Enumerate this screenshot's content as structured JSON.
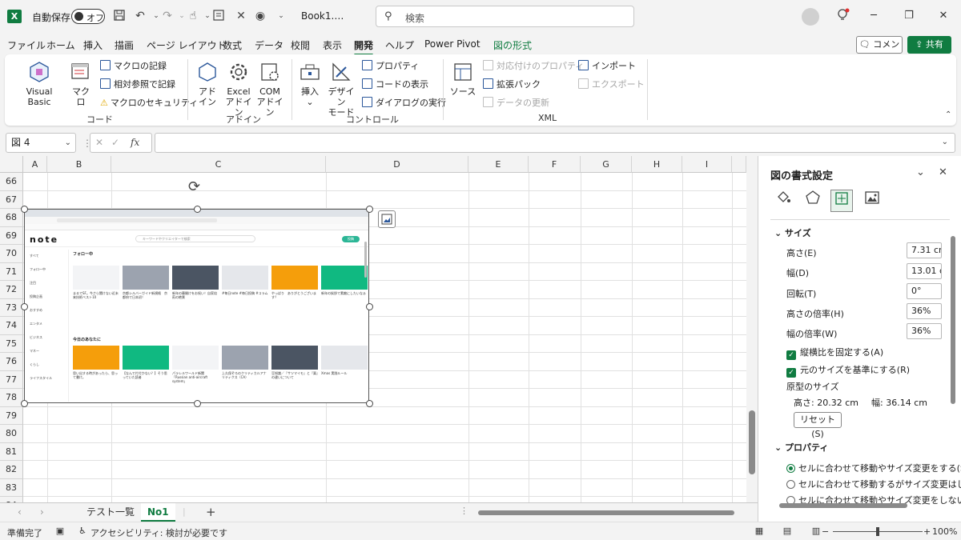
{
  "titlebar": {
    "autosave_label": "自動保存",
    "autosave_state": "オフ",
    "filename": "Book1.…",
    "search_placeholder": "検索"
  },
  "menu": {
    "tabs": [
      "ファイル",
      "ホーム",
      "挿入",
      "描画",
      "ページ レイアウト",
      "数式",
      "データ",
      "校閲",
      "表示",
      "開発",
      "ヘルプ",
      "Power Pivot",
      "図の形式"
    ],
    "active_tab": "開発",
    "comment": "コメント",
    "share": "共有"
  },
  "ribbon": {
    "code": {
      "visual_basic": "Visual Basic",
      "macro": "マクロ",
      "record_macro": "マクロの記録",
      "relative_ref": "相対参照で記録",
      "macro_security": "マクロのセキュリティ",
      "label": "コード"
    },
    "addin": {
      "addin_line1": "アド",
      "addin_line2": "イン",
      "excel_line1": "Excel",
      "excel_line2": "アドイン",
      "com_line1": "COM",
      "com_line2": "アドイン",
      "label": "アドイン"
    },
    "control": {
      "insert": "挿入",
      "design_line1": "デザイン",
      "design_line2": "モード",
      "properties": "プロパティ",
      "view_code": "コードの表示",
      "run_dialog": "ダイアログの実行",
      "label": "コントロール"
    },
    "xml": {
      "source": "ソース",
      "map_properties": "対応付けのプロパティ",
      "expansion_packs": "拡張パック",
      "refresh_data": "データの更新",
      "import": "インポート",
      "export": "エクスポート",
      "label": "XML"
    }
  },
  "formula_bar": {
    "name_box": "図 4",
    "fx": "fx",
    "value": ""
  },
  "grid": {
    "columns": [
      "A",
      "B",
      "C",
      "D",
      "E",
      "F",
      "G",
      "H",
      "I"
    ],
    "rows": [
      "66",
      "67",
      "68",
      "69",
      "70",
      "71",
      "72",
      "73",
      "74",
      "75",
      "76",
      "77",
      "78",
      "79",
      "80",
      "81",
      "82",
      "83",
      "84"
    ]
  },
  "screenshot": {
    "logo": "note",
    "search_placeholder": "キーワードやクリエイターで検索",
    "post_button": "投稿",
    "section_following": "フォロー中",
    "section_today": "今日のあなたに",
    "sidebar": [
      "すべて",
      "フォロー中",
      "注目",
      "投稿企画",
      "おすすめ",
      "エンタメ",
      "ビジネス",
      "マネー",
      "くらし",
      "ライフスタイル"
    ],
    "cards_row1": [
      "まるでSF。今さら聞けない近未来技術ベスト10",
      "京都シルバーガイド新規格　京都府で日本初！",
      "新年の幕開けをお祝い！自家焙煎の絶景",
      "#毎日note #毎日投稿 #コラム",
      "やっぱり　ありがとうございます？",
      "新年の挨拶で素敵にしたいなぁ"
    ],
    "cards_row2": [
      "思い出する時があったら、思って書け。",
      "【なんで片付かない？】そう思っていた読者",
      "パラレルワールド新聞「Russian anti-aircraft system」",
      "上久保ぞろのクリティカルアナリティクス（CA）",
      "豆知識／『サツマイモ』と『栗』の違いについて",
      "Xmas 実践ルール"
    ]
  },
  "sheets": {
    "tabs": [
      "テスト一覧",
      "No1"
    ],
    "active": "No1",
    "add": "+"
  },
  "status": {
    "ready": "準備完了",
    "accessibility": "アクセシビリティ: 検討が必要です",
    "zoom": "100%"
  },
  "pane": {
    "title": "図の書式設定",
    "size_section": "サイズ",
    "height_label": "高さ(E)",
    "height_value": "7.31 cm",
    "width_label": "幅(D)",
    "width_value": "13.01 cm",
    "rotation_label": "回転(T)",
    "rotation_value": "0°",
    "scale_height_label": "高さの倍率(H)",
    "scale_height_value": "36%",
    "scale_width_label": "幅の倍率(W)",
    "scale_width_value": "36%",
    "lock_aspect": "縦横比を固定する(A)",
    "relative_original": "元のサイズを基準にする(R)",
    "original_size_label": "原型のサイズ",
    "original_height": "高さ:   20.32 cm",
    "original_width": "幅:   36.14 cm",
    "reset": "リセット(S)",
    "properties_section": "プロパティ",
    "radio1": "セルに合わせて移動やサイズ変更をする(S)",
    "radio2": "セルに合わせて移動するがサイズ変更はしない",
    "radio3": "セルに合わせて移動やサイズ変更をしない"
  },
  "colors": {
    "accent": "#107c41",
    "ribbon_icon": "#2b579a"
  }
}
